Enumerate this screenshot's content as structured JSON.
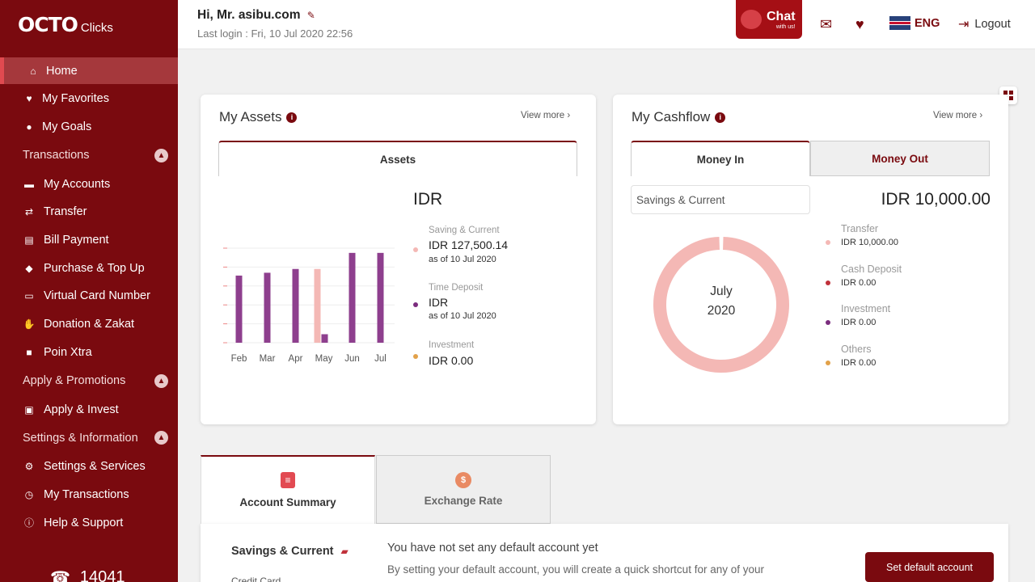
{
  "sidebar": {
    "logo_main": "OCTO",
    "logo_sub": "Clicks",
    "items": [
      {
        "label": "Home",
        "icon": "home-icon"
      },
      {
        "label": "My Favorites",
        "icon": "heart-icon"
      },
      {
        "label": "My Goals",
        "icon": "location-pin-icon"
      },
      {
        "section": "Transactions"
      },
      {
        "label": "My Accounts",
        "icon": "card-icon"
      },
      {
        "label": "Transfer",
        "icon": "transfer-icon"
      },
      {
        "label": "Bill Payment",
        "icon": "bill-icon"
      },
      {
        "label": "Purchase & Top Up",
        "icon": "tag-icon"
      },
      {
        "label": "Virtual Card Number",
        "icon": "virtual-card-icon"
      },
      {
        "label": "Donation & Zakat",
        "icon": "donation-icon"
      },
      {
        "label": "Poin Xtra",
        "icon": "gift-icon"
      },
      {
        "section": "Apply & Promotions"
      },
      {
        "label": "Apply & Invest",
        "icon": "apply-icon"
      },
      {
        "section": "Settings & Information"
      },
      {
        "label": "Settings & Services",
        "icon": "settings-icon"
      },
      {
        "label": "My Transactions",
        "icon": "history-icon"
      },
      {
        "label": "Help & Support",
        "icon": "info-icon"
      }
    ],
    "phone": "14041"
  },
  "header": {
    "greeting": "Hi, Mr. asibu.com",
    "last_login": "Last login : Fri, 10 Jul 2020 22:56",
    "chat_title": "Chat",
    "chat_sub": "with us!",
    "language": "ENG",
    "logout": "Logout"
  },
  "assets": {
    "title": "My Assets",
    "view_more": "View more",
    "tab": "Assets",
    "currency": "IDR",
    "legend": [
      {
        "category": "Saving & Current",
        "value": "IDR 127,500.14",
        "as_of": "as of 10 Jul 2020",
        "color": "#f4b8b5"
      },
      {
        "category": "Time Deposit",
        "value": "IDR",
        "as_of": "as of 10 Jul 2020",
        "color": "#7b2d7e"
      },
      {
        "category": "Investment",
        "value": "IDR 0.00",
        "as_of": "",
        "color": "#e2a14a"
      }
    ]
  },
  "cashflow": {
    "title": "My Cashflow",
    "view_more": "View more",
    "tab_in": "Money In",
    "tab_out": "Money Out",
    "select": "Savings & Current",
    "total": "IDR 10,000.00",
    "donut_line1": "July",
    "donut_line2": "2020",
    "legend": [
      {
        "category": "Transfer",
        "value": "IDR 10,000.00",
        "color": "#f4b8b5"
      },
      {
        "category": "Cash Deposit",
        "value": "IDR 0.00",
        "color": "#c0313a"
      },
      {
        "category": "Investment",
        "value": "IDR 0.00",
        "color": "#7b2d7e"
      },
      {
        "category": "Others",
        "value": "IDR 0.00",
        "color": "#e2a14a"
      }
    ]
  },
  "bottom": {
    "tab_summary": "Account Summary",
    "tab_exchange": "Exchange Rate",
    "savings_label": "Savings & Current",
    "credit_label": "Credit Card",
    "no_default": "You have not set any default account yet",
    "desc": "By setting your default account, you will create a quick shortcut for any of your",
    "set_default": "Set default account"
  },
  "chart_data": [
    {
      "type": "bar",
      "categories": [
        "Feb",
        "Mar",
        "Apr",
        "May",
        "Jun",
        "Jul"
      ],
      "series": [
        {
          "name": "Saving & Current",
          "color": "#f4b8b5",
          "values": [
            0,
            0,
            0,
            0.78,
            0,
            0
          ]
        },
        {
          "name": "Time Deposit",
          "color": "#8e3f8e",
          "values": [
            0.71,
            0.74,
            0.78,
            0.09,
            0.95,
            0.95
          ]
        }
      ],
      "ylim": [
        0,
        1
      ]
    },
    {
      "type": "pie",
      "labels": [
        "Transfer",
        "Cash Deposit",
        "Investment",
        "Others"
      ],
      "values": [
        10000,
        0,
        0,
        0
      ],
      "colors": [
        "#f4b8b5",
        "#c0313a",
        "#7b2d7e",
        "#e2a14a"
      ]
    }
  ]
}
